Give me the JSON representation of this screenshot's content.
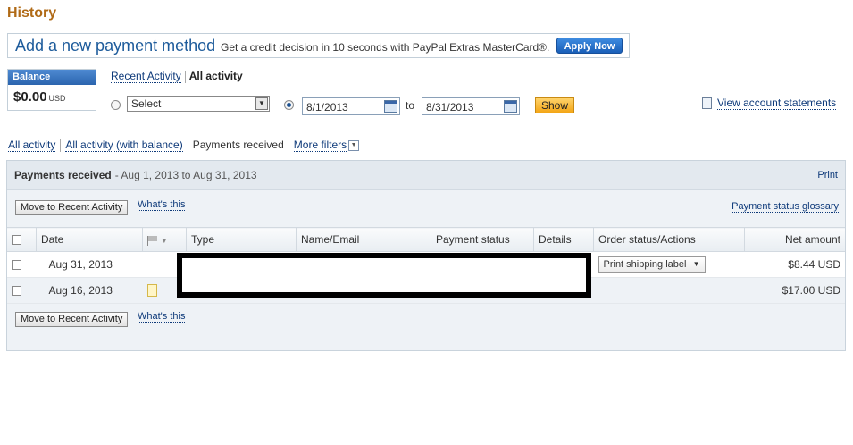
{
  "page": {
    "title": "History"
  },
  "promo": {
    "headline": "Add a new payment method",
    "text": "Get a credit decision in 10 seconds with PayPal Extras MasterCard®.",
    "button": "Apply Now"
  },
  "balance": {
    "label": "Balance",
    "amount": "$0.00",
    "currency": "USD"
  },
  "view_tabs": {
    "recent": "Recent Activity",
    "all": "All activity"
  },
  "date_filter": {
    "select_value": "Select",
    "from": "8/1/2013",
    "to_label": "to",
    "to": "8/31/2013",
    "show": "Show",
    "statements_link": "View account statements"
  },
  "filter_bar": {
    "all_activity": "All activity",
    "all_activity_balance": "All activity (with balance)",
    "payments_received": "Payments received",
    "more_filters": "More filters"
  },
  "panel": {
    "title": "Payments received",
    "range": "- Aug 1, 2013 to Aug 31, 2013",
    "print": "Print",
    "move_button": "Move to Recent Activity",
    "whats_this": "What's this",
    "glossary": "Payment status glossary"
  },
  "table": {
    "headers": {
      "date": "Date",
      "type": "Type",
      "name_email": "Name/Email",
      "payment_status": "Payment status",
      "details": "Details",
      "order_status": "Order status/Actions",
      "net_amount": "Net amount"
    },
    "rows": [
      {
        "date": "Aug 31, 2013",
        "action": "Print shipping label",
        "net": "$8.44 USD"
      },
      {
        "date": "Aug 16, 2013",
        "action": "",
        "net": "$17.00 USD"
      }
    ]
  }
}
